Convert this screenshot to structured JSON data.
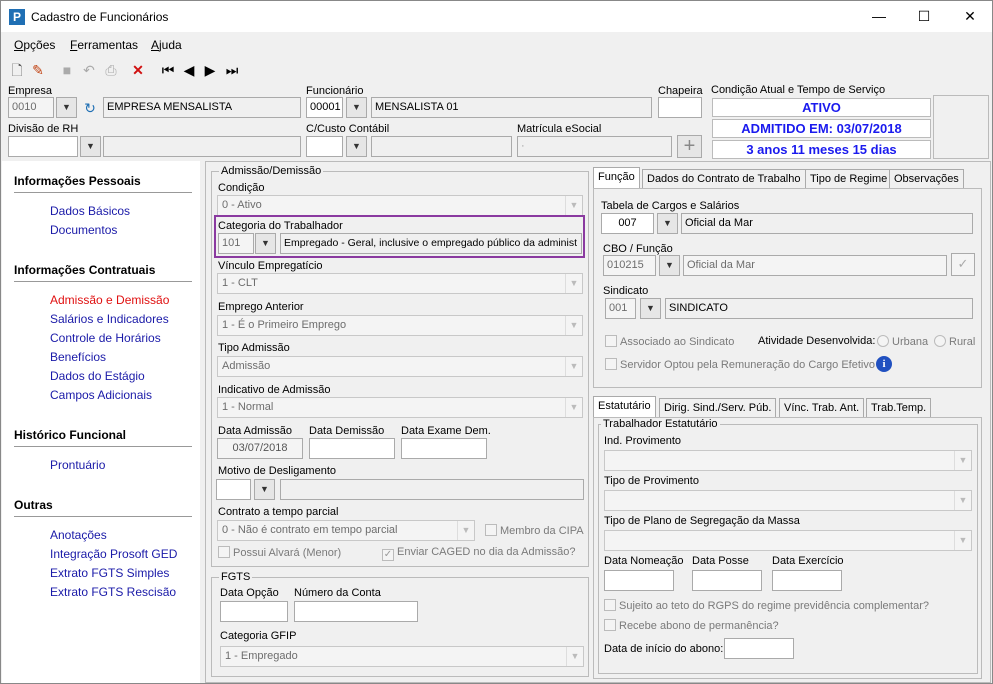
{
  "window": {
    "title": "Cadastro de Funcionários",
    "minimize": "—",
    "maximize": "☐",
    "close": "✕"
  },
  "menu": [
    "Opções",
    "Ferramentas",
    "Ajuda"
  ],
  "header": {
    "empresa_label": "Empresa",
    "empresa_code": "0010",
    "empresa_name": "EMPRESA MENSALISTA",
    "funcionario_label": "Funcionário",
    "funcionario_code": "00001",
    "funcionario_name": "MENSALISTA 01",
    "chapeira_label": "Chapeira",
    "chapeira_value": "",
    "divisao_label": "Divisão de RH",
    "divisao_value": "",
    "custo_label": "C/Custo Contábil",
    "custo_value": "",
    "matricula_label": "Matrícula eSocial",
    "matricula_value": "·",
    "condicao_label": "Condição Atual e Tempo de Serviço",
    "status": "ATIVO",
    "admitido": "ADMITIDO EM: 03/07/2018",
    "tempo": "3 anos 11 meses 15 dias"
  },
  "sidebar": {
    "sections": [
      {
        "title": "Informações Pessoais",
        "items": [
          "Dados Básicos",
          "Documentos"
        ]
      },
      {
        "title": "Informações Contratuais",
        "items": [
          "Admissão e Demissão",
          "Salários e Indicadores",
          "Controle de Horários",
          "Benefícios",
          "Dados do Estágio",
          "Campos Adicionais"
        ]
      },
      {
        "title": "Histórico Funcional",
        "items": [
          "Prontuário"
        ]
      },
      {
        "title": "Outras",
        "items": [
          "Anotações",
          "Integração Prosoft GED",
          "Extrato FGTS Simples",
          "Extrato FGTS Rescisão"
        ]
      }
    ],
    "active_item": "Admissão e Demissão"
  },
  "admissao": {
    "group_title": "Admissão/Demissão",
    "condicao_label": "Condição",
    "condicao_value": "0 - Ativo",
    "categoria_label": "Categoria do Trabalhador",
    "categoria_code": "101",
    "categoria_desc": "Empregado - Geral, inclusive o empregado público da administ",
    "vinculo_label": "Vínculo Empregatício",
    "vinculo_value": "1 - CLT",
    "emprego_label": "Emprego Anterior",
    "emprego_value": "1 - É o Primeiro Emprego",
    "tipo_label": "Tipo Admissão",
    "tipo_value": "Admissão",
    "indicativo_label": "Indicativo de Admissão",
    "indicativo_value": "1 - Normal",
    "data_adm_label": "Data Admissão",
    "data_adm_value": "03/07/2018",
    "data_dem_label": "Data Demissão",
    "data_dem_value": "",
    "data_exame_label": "Data Exame Dem.",
    "data_exame_value": "",
    "motivo_label": "Motivo de Desligamento",
    "contrato_label": "Contrato a tempo parcial",
    "contrato_value": "0 - Não é contrato em tempo parcial",
    "membro_cipa": "Membro da CIPA",
    "possui_alvara": "Possui Alvará (Menor)",
    "enviar_caged": "Enviar CAGED no dia da Admissão?"
  },
  "fgts": {
    "group_title": "FGTS",
    "data_opcao_label": "Data Opção",
    "numero_conta_label": "Número da Conta",
    "categoria_gfip_label": "Categoria GFIP",
    "categoria_gfip_value": "1 - Empregado"
  },
  "tabs_top": [
    "Função",
    "Dados do Contrato de Trabalho",
    "Tipo de Regime",
    "Observações"
  ],
  "funcao": {
    "tabela_label": "Tabela de Cargos e Salários",
    "tabela_code": "007",
    "tabela_desc": "Oficial da Mar",
    "cbo_label": "CBO / Função",
    "cbo_code": "010215",
    "cbo_desc": "Oficial da Mar",
    "sindicato_label": "Sindicato",
    "sindicato_code": "001",
    "sindicato_desc": "SINDICATO",
    "associado": "Associado ao Sindicato",
    "atividade_label": "Atividade Desenvolvida:",
    "urbana": "Urbana",
    "rural": "Rural",
    "servidor": "Servidor Optou pela Remuneração do Cargo Efetivo"
  },
  "tabs_bottom": [
    "Estatutário",
    "Dirig. Sind./Serv. Púb.",
    "Vínc. Trab. Ant.",
    "Trab.Temp."
  ],
  "estatutario": {
    "group_title": "Trabalhador Estatutário",
    "ind_label": "Ind. Provimento",
    "tipo_prov_label": "Tipo de Provimento",
    "tipo_plano_label": "Tipo de Plano de Segregação da Massa",
    "data_nomeacao_label": "Data Nomeação",
    "data_posse_label": "Data Posse",
    "data_exercicio_label": "Data Exercício",
    "sujeito": "Sujeito ao teto do RGPS do regime previdência complementar?",
    "recebe": "Recebe abono de permanência?",
    "data_inicio_label": "Data de início do abono:"
  }
}
